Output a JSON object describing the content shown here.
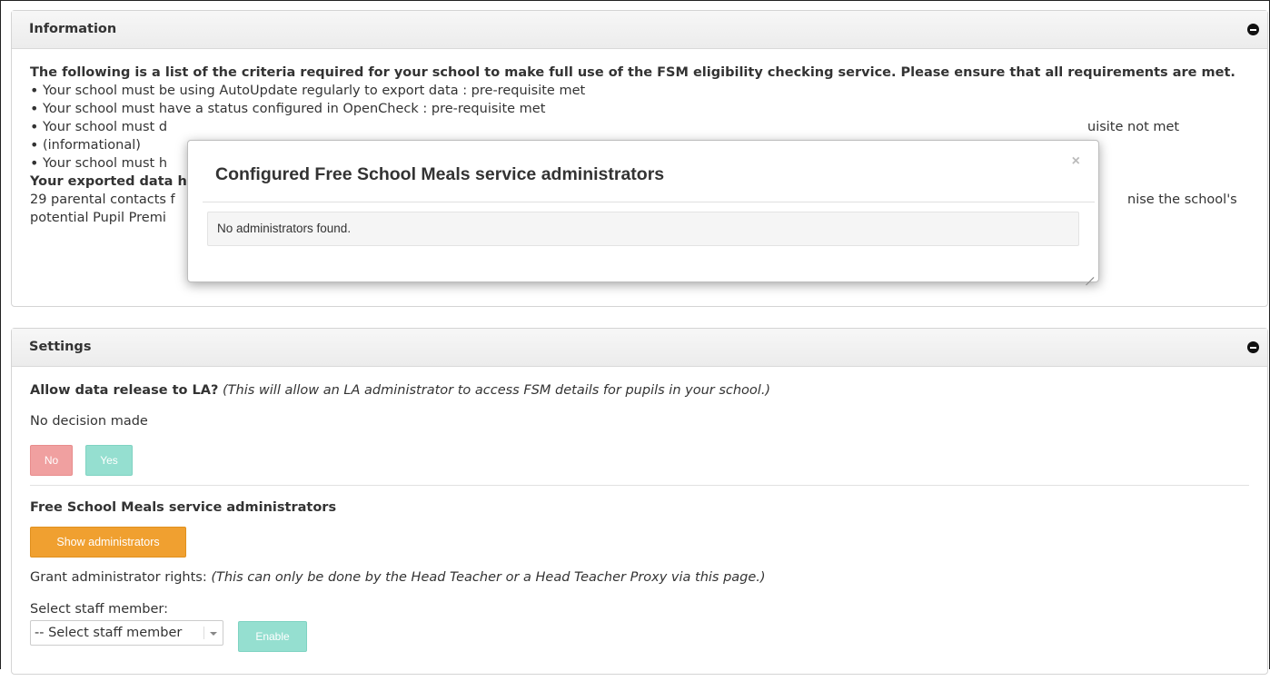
{
  "information": {
    "title": "Information",
    "intro": "The following is a list of the criteria required for your school to make full use of the FSM eligibility checking service. Please ensure that all requirements are met.",
    "requirements": [
      "Your school must be using AutoUpdate regularly to export data : pre-requisite met",
      "Your school must have a status configured in OpenCheck : pre-requisite met",
      "Your school must d",
      "(informational)",
      "Your school must h"
    ],
    "req3_tail": "uisite not met",
    "exported_heading": "Your exported data h",
    "exported_line1_start": "29 parental contacts f",
    "exported_line1_end": "nise the school's",
    "exported_line2": "potential Pupil Premi"
  },
  "settings": {
    "title": "Settings",
    "release_question": "Allow data release to LA?",
    "release_note": "(This will allow an LA administrator to access FSM details for pupils in your school.)",
    "decision_status": "No decision made",
    "no_label": "No",
    "yes_label": "Yes",
    "fsm_admins_title": "Free School Meals service administrators",
    "show_admins_label": "Show administrators",
    "grant_label": "Grant administrator rights:",
    "grant_note": "(This can only be done by the Head Teacher or a Head Teacher Proxy via this page.)",
    "select_staff_label": "Select staff member:",
    "select_staff_value": "-- Select staff member",
    "enable_label": "Enable"
  },
  "modal": {
    "title": "Configured Free School Meals service administrators",
    "close_glyph": "×",
    "message": "No administrators found."
  },
  "icons": {
    "collapse": "minus-circle-icon",
    "close": "close-icon",
    "resize": "resize-handle-icon"
  },
  "colors": {
    "no_button": "#f0a0a0",
    "yes_button": "#95dfd0",
    "show_button": "#f0a030",
    "enable_button": "#95dfd0"
  }
}
